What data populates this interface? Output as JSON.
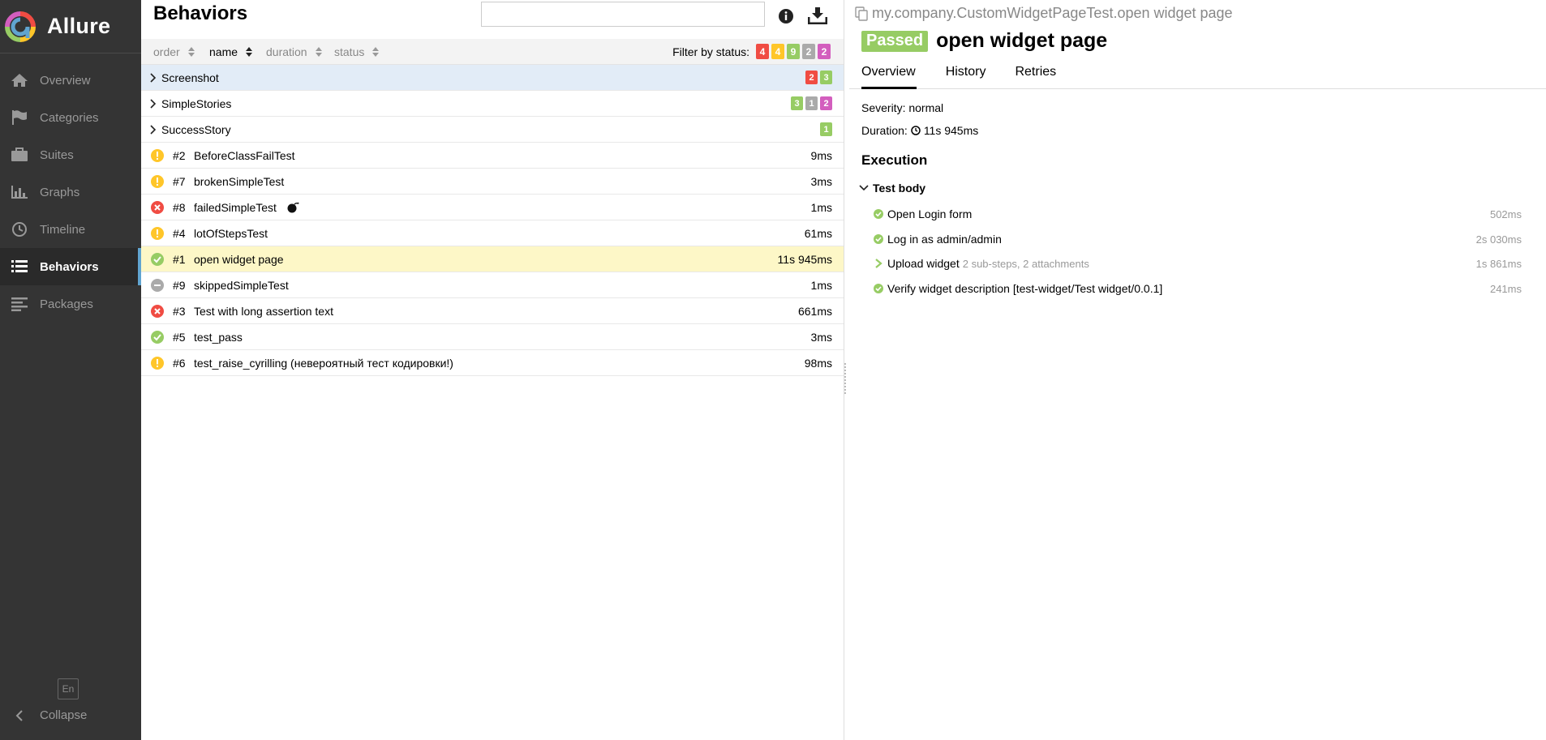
{
  "colors": {
    "failed": "#f04c43",
    "broken": "#ffc629",
    "passed": "#97cc64",
    "skipped": "#aaaaaa",
    "unknown": "#d35ebe",
    "sidebar": "#343434",
    "accent": "#60a4d0"
  },
  "sidebar": {
    "brand": "Allure",
    "items": [
      {
        "label": "Overview",
        "icon": "home-icon"
      },
      {
        "label": "Categories",
        "icon": "flag-icon"
      },
      {
        "label": "Suites",
        "icon": "briefcase-icon"
      },
      {
        "label": "Graphs",
        "icon": "bar-chart-icon"
      },
      {
        "label": "Timeline",
        "icon": "clock-icon"
      },
      {
        "label": "Behaviors",
        "icon": "list-icon",
        "active": true
      },
      {
        "label": "Packages",
        "icon": "align-left-icon"
      }
    ],
    "lang": "En",
    "collapse": "Collapse"
  },
  "middle": {
    "title": "Behaviors",
    "search": {
      "value": "",
      "placeholder": ""
    },
    "sort": [
      {
        "label": "order"
      },
      {
        "label": "name",
        "active": true
      },
      {
        "label": "duration"
      },
      {
        "label": "status"
      }
    ],
    "filter": {
      "label": "Filter by status:",
      "badges": [
        {
          "value": "4",
          "status": "failed"
        },
        {
          "value": "4",
          "status": "broken"
        },
        {
          "value": "9",
          "status": "passed"
        },
        {
          "value": "2",
          "status": "skipped"
        },
        {
          "value": "2",
          "status": "unknown"
        }
      ]
    },
    "groups": [
      {
        "name": "Screenshot",
        "badges": [
          {
            "value": "2",
            "status": "failed"
          },
          {
            "value": "3",
            "status": "passed"
          }
        ]
      },
      {
        "name": "SimpleStories",
        "badges": [
          {
            "value": "3",
            "status": "passed"
          },
          {
            "value": "1",
            "status": "skipped"
          },
          {
            "value": "2",
            "status": "unknown"
          }
        ]
      },
      {
        "name": "SuccessStory",
        "badges": [
          {
            "value": "1",
            "status": "passed"
          }
        ]
      }
    ],
    "tests": [
      {
        "num": "#2",
        "name": "BeforeClassFailTest",
        "duration": "9ms",
        "status": "broken"
      },
      {
        "num": "#7",
        "name": "brokenSimpleTest",
        "duration": "3ms",
        "status": "broken"
      },
      {
        "num": "#8",
        "name": "failedSimpleTest",
        "duration": "1ms",
        "status": "failed",
        "flaky": "bomb-icon"
      },
      {
        "num": "#4",
        "name": "lotOfStepsTest",
        "duration": "61ms",
        "status": "broken"
      },
      {
        "num": "#1",
        "name": "open widget page",
        "duration": "11s 945ms",
        "status": "passed",
        "selected": true
      },
      {
        "num": "#9",
        "name": "skippedSimpleTest",
        "duration": "1ms",
        "status": "skipped"
      },
      {
        "num": "#3",
        "name": "Test with long assertion text",
        "duration": "661ms",
        "status": "failed"
      },
      {
        "num": "#5",
        "name": "test_pass",
        "duration": "3ms",
        "status": "passed"
      },
      {
        "num": "#6",
        "name": "test_raise_cyrilling (невероятный тест кодировки!)",
        "duration": "98ms",
        "status": "broken"
      }
    ]
  },
  "detail": {
    "path": "my.company.CustomWidgetPageTest.open widget page",
    "status_label": "Passed",
    "title": "open widget page",
    "tabs": [
      "Overview",
      "History",
      "Retries"
    ],
    "severity_label": "Severity:",
    "severity": "normal",
    "duration_label": "Duration:",
    "duration": "11s 945ms",
    "execution_title": "Execution",
    "test_body": "Test body",
    "steps": [
      {
        "name": "Open Login form",
        "duration": "502ms",
        "status": "passed"
      },
      {
        "name": "Log in as admin/admin",
        "duration": "2s 030ms",
        "status": "passed"
      },
      {
        "name": "Upload widget",
        "sub": "2 sub-steps, 2 attachments",
        "duration": "1s 861ms",
        "expandable": true
      },
      {
        "name": "Verify widget description [test-widget/Test widget/0.0.1]",
        "duration": "241ms",
        "status": "passed"
      }
    ]
  }
}
